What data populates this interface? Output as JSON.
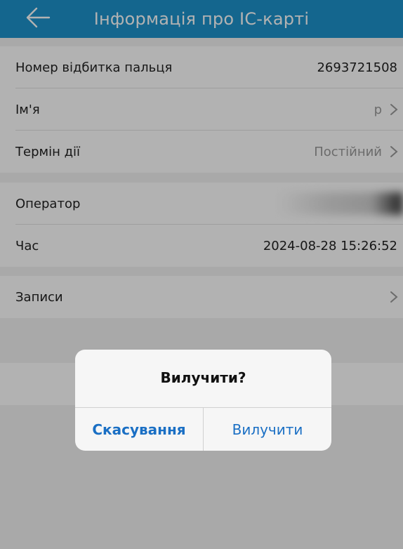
{
  "header": {
    "title": "Інформація про IC-карті",
    "back_icon": "arrow-left-icon"
  },
  "card_info": {
    "fingerprint_label": "Номер відбитка пальця",
    "fingerprint_value": "2693721508",
    "name_label": "Ім'я",
    "name_value": "р",
    "validity_label": "Термін дії",
    "validity_value": "Постійний"
  },
  "operation": {
    "operator_label": "Оператор",
    "time_label": "Час",
    "time_value": "2024-08-28 15:26:52"
  },
  "records": {
    "label": "Записи"
  },
  "dialog": {
    "title": "Вилучити?",
    "cancel_label": "Скасування",
    "confirm_label": "Вилучити"
  }
}
